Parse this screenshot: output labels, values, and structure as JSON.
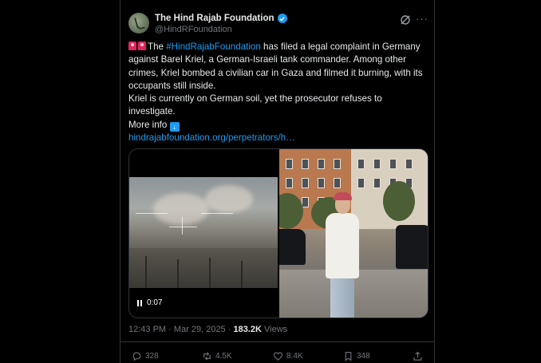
{
  "author": {
    "display_name": "The Hind Rajab Foundation",
    "handle": "@HindRFoundation"
  },
  "tweet": {
    "prefix": "The ",
    "hashtag": "#HindRajabFoundation",
    "line1_rest": " has filed a legal complaint in Germany against Barel Kriel, a German-Israeli tank commander. Among other crimes, Kriel bombed a civilian car in Gaza and filmed it burning, with its occupants still inside.",
    "line2": "Kriel is currently on German soil, yet the prosecutor refuses to investigate.",
    "more_info": "More info ",
    "link": "hindrajabfoundation.org/perpetrators/h…"
  },
  "media": {
    "video_time": "0:07"
  },
  "meta": {
    "time": "12:43 PM · Mar 29, 2025 · ",
    "views_count": "183.2K",
    "views_label": " Views"
  },
  "actions": {
    "replies": "328",
    "reposts": "4.5K",
    "likes": "8.4K",
    "bookmarks": "348"
  },
  "colors": {
    "accent": "#1d9bf0",
    "background": "#000000",
    "text": "#e7e9ea",
    "muted": "#71767b"
  }
}
